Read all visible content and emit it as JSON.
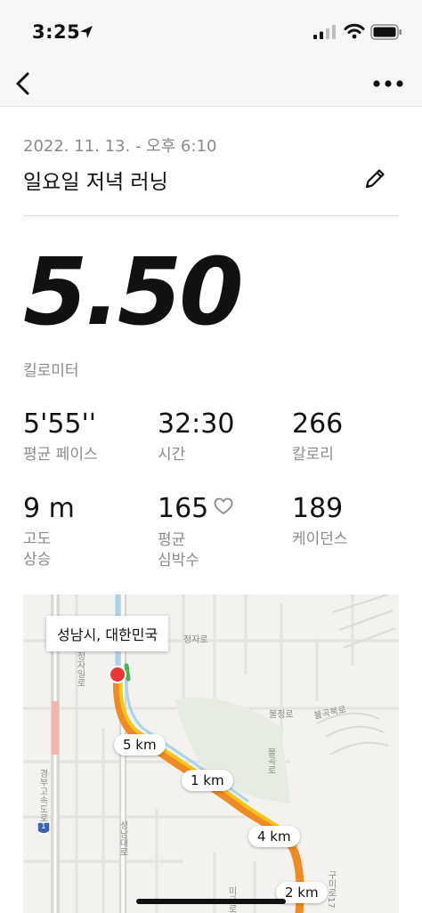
{
  "status_bar": {
    "time": "3:25"
  },
  "run": {
    "date": "2022. 11. 13. - 오후 6:10",
    "title": "일요일 저녁 러닝",
    "distance": "5.50",
    "distance_unit": "킬로미터"
  },
  "stats": [
    {
      "value": "5'55''",
      "label": "평균 페이스"
    },
    {
      "value": "32:30",
      "label": "시간"
    },
    {
      "value": "266",
      "label": "칼로리"
    },
    {
      "value": "9 m",
      "label": "고도\n상승"
    },
    {
      "value": "165",
      "label": "평균\n심박수"
    },
    {
      "value": "189",
      "label": "케이던스"
    }
  ],
  "map": {
    "callout": "성남시, 대한민국",
    "km_markers": [
      "5 km",
      "1 km",
      "4 km",
      "2 km"
    ],
    "street_labels": [
      "정자로",
      "정자일로",
      "불정로",
      "불곡북로",
      "불곡로",
      "경부고속도로",
      "성남대로",
      "구미로17",
      "미금로",
      "1"
    ],
    "colors": {
      "route_fast": "#4caf50",
      "route_mid": "#f5c518",
      "route_slow": "#f08a24",
      "start_marker": "#e53935"
    }
  },
  "icons": [
    "location-arrow-icon",
    "signal-icon",
    "wifi-icon",
    "battery-icon",
    "back-chevron-icon",
    "more-dots-icon",
    "pencil-icon",
    "heart-icon"
  ]
}
